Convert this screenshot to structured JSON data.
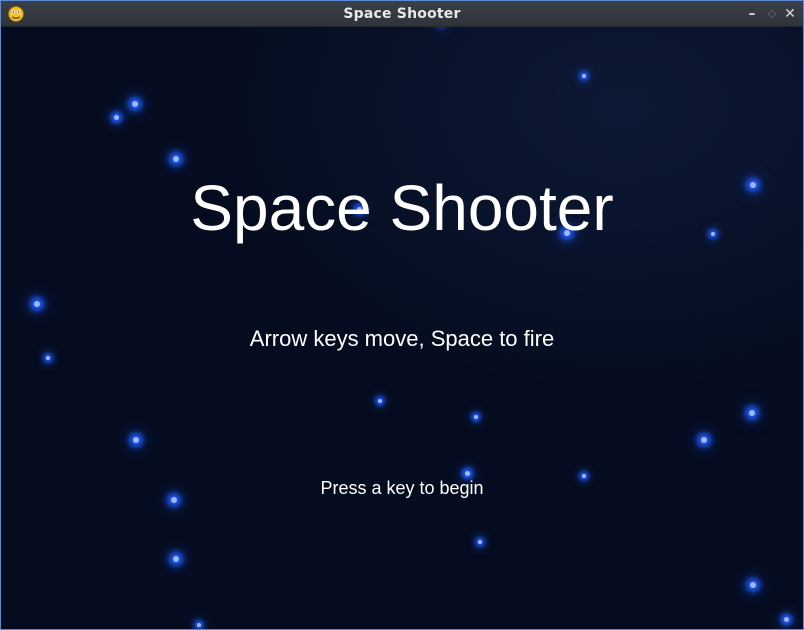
{
  "window": {
    "title": "Space Shooter",
    "controls": {
      "minimize": "–",
      "maximize": "◇",
      "close": "✕"
    }
  },
  "game": {
    "title": "Space Shooter",
    "instructions": "Arrow keys move, Space to fire",
    "prompt": "Press a key to begin"
  },
  "colors": {
    "background": "#050c1f",
    "star_core": "#9fb8ff",
    "star_glow": "#1f5cff",
    "text": "#ffffff"
  }
}
